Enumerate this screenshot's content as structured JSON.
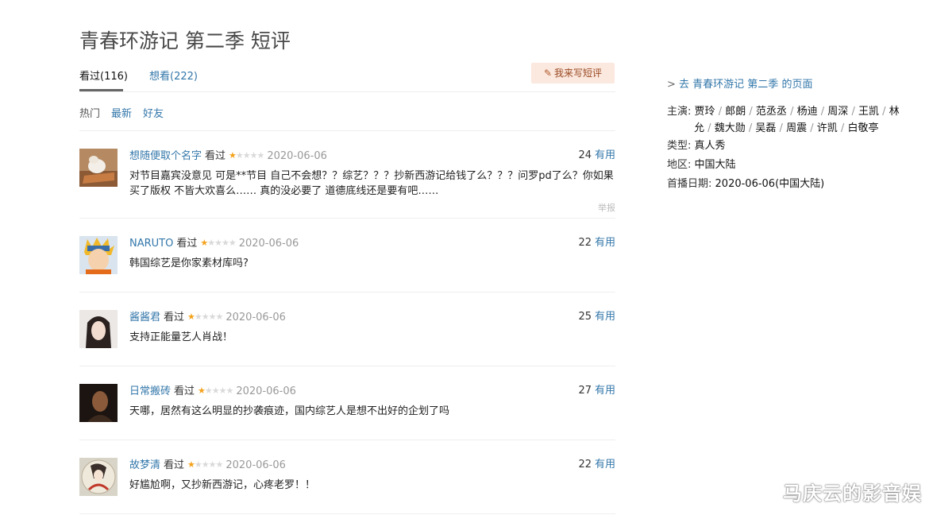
{
  "page_title": "青春环游记 第二季 短评",
  "tabs": [
    {
      "label": "看过(116)"
    },
    {
      "label": "想看(222)"
    }
  ],
  "write_button": {
    "label": "我来写短评"
  },
  "sort_options": [
    {
      "label": "热门"
    },
    {
      "label": "最新"
    },
    {
      "label": "好友"
    }
  ],
  "reviews": [
    {
      "user": "想随便取个名字",
      "action": "看过",
      "rating": 1,
      "date": "2020-06-06",
      "useful_count": "24",
      "useful_label": "有用",
      "content": "对节目嘉宾没意见 可是**节目 自己不会想？？综艺？？？抄新西游记给钱了么？？？问罗pd了么？你如果买了版权 不皆大欢喜么…… 真的没必要了 道德底线还是要有吧……",
      "report_label": "举报"
    },
    {
      "user": "NARUTO",
      "action": "看过",
      "rating": 1,
      "date": "2020-06-06",
      "useful_count": "22",
      "useful_label": "有用",
      "content": "韩国综艺是你家素材库吗?"
    },
    {
      "user": "酱酱君",
      "action": "看过",
      "rating": 1,
      "date": "2020-06-06",
      "useful_count": "25",
      "useful_label": "有用",
      "content": "支持正能量艺人肖战！"
    },
    {
      "user": "日常搬砖",
      "action": "看过",
      "rating": 1,
      "date": "2020-06-06",
      "useful_count": "27",
      "useful_label": "有用",
      "content": "天哪，居然有这么明显的抄袭痕迹，国内综艺人是想不出好的企划了吗"
    },
    {
      "user": "故梦清",
      "action": "看过",
      "rating": 1,
      "date": "2020-06-06",
      "useful_count": "22",
      "useful_label": "有用",
      "content": "好尴尬啊，又抄新西游记，心疼老罗！！"
    }
  ],
  "sidebar": {
    "goto_prefix": ">",
    "goto_text": "去 青春环游记 第二季 的页面",
    "cast_label": "主演:",
    "cast": [
      "贾玲",
      "郎朗",
      "范丞丞",
      "杨迪",
      "周深",
      "王凯",
      "林允",
      "魏大勋",
      "吴磊",
      "周震",
      "许凯",
      "白敬亭"
    ],
    "cast_sep": "/",
    "genre_label": "类型:",
    "genre": "真人秀",
    "region_label": "地区:",
    "region": "中国大陆",
    "premiere_label": "首播日期:",
    "premiere": "2020-06-06(中国大陆)"
  },
  "watermark": "马庆云的影音娱",
  "colors": {
    "link": "#3377aa",
    "star": "#f4a21b",
    "button_bg": "#fbe8de"
  }
}
